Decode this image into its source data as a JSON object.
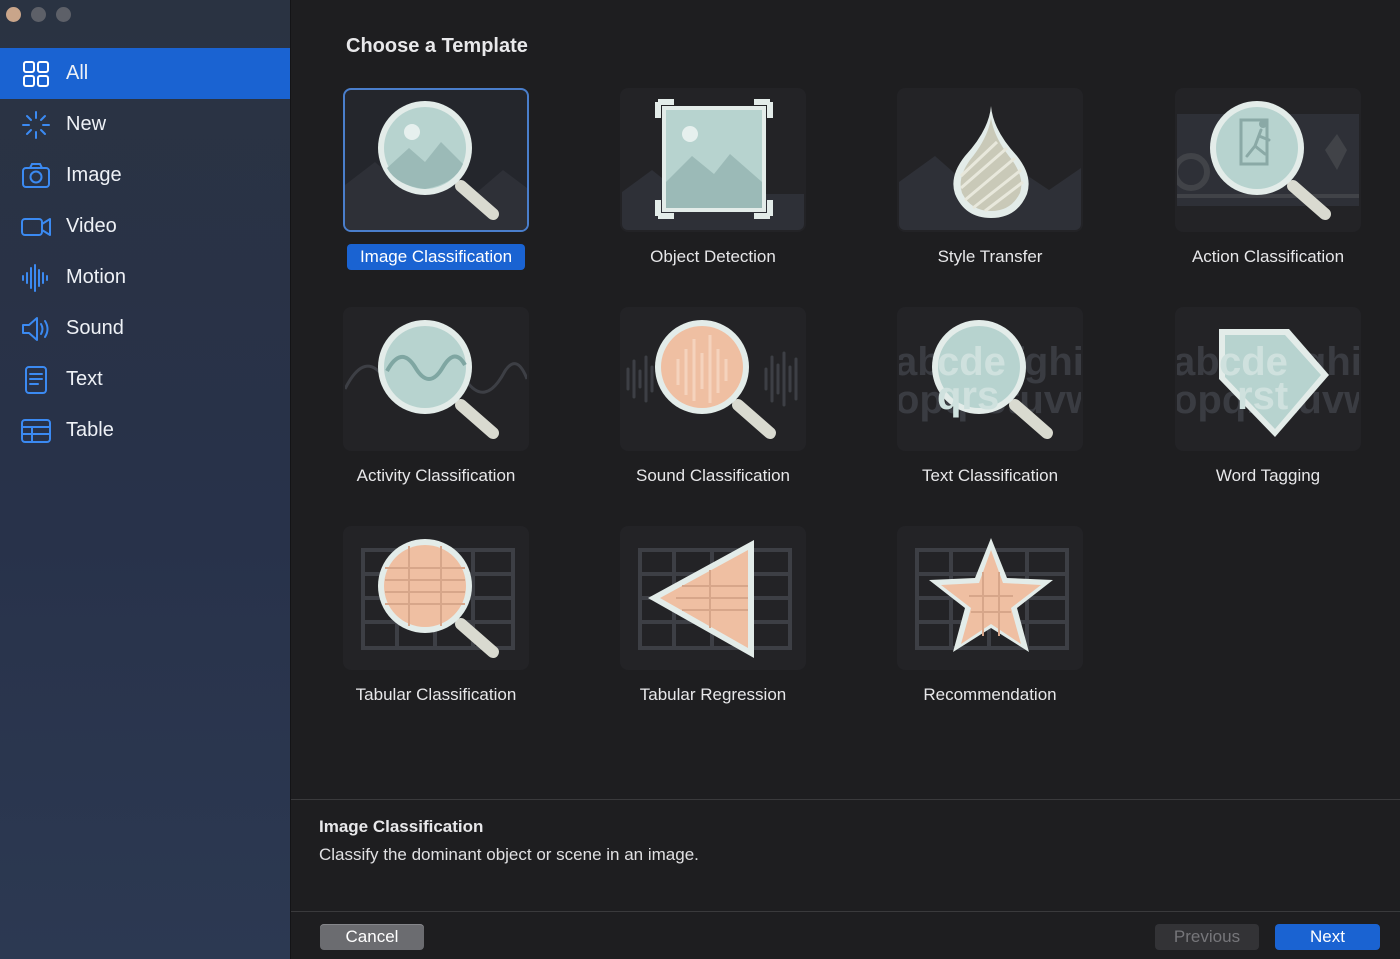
{
  "window": {
    "traffic_lights": [
      "close",
      "minimize",
      "zoom"
    ]
  },
  "sidebar": {
    "items": [
      {
        "label": "All",
        "icon": "grid-icon",
        "active": true
      },
      {
        "label": "New",
        "icon": "sparkle-icon",
        "active": false
      },
      {
        "label": "Image",
        "icon": "camera-icon",
        "active": false
      },
      {
        "label": "Video",
        "icon": "video-camera-icon",
        "active": false
      },
      {
        "label": "Motion",
        "icon": "waveform-icon",
        "active": false
      },
      {
        "label": "Sound",
        "icon": "speaker-icon",
        "active": false
      },
      {
        "label": "Text",
        "icon": "document-icon",
        "active": false
      },
      {
        "label": "Table",
        "icon": "table-icon",
        "active": false
      }
    ]
  },
  "main": {
    "heading": "Choose a Template",
    "templates": [
      {
        "label": "Image Classification",
        "icon": "magnifier-image-icon",
        "selected": true
      },
      {
        "label": "Object Detection",
        "icon": "framed-image-icon",
        "selected": false
      },
      {
        "label": "Style Transfer",
        "icon": "paint-drop-icon",
        "selected": false
      },
      {
        "label": "Action Classification",
        "icon": "magnifier-running-figure-icon",
        "selected": false
      },
      {
        "label": "Activity Classification",
        "icon": "magnifier-sine-wave-icon",
        "selected": false
      },
      {
        "label": "Sound Classification",
        "icon": "magnifier-audio-wave-icon",
        "selected": false
      },
      {
        "label": "Text Classification",
        "icon": "magnifier-letters-icon",
        "selected": false
      },
      {
        "label": "Word Tagging",
        "icon": "tag-letters-icon",
        "selected": false
      },
      {
        "label": "Tabular Classification",
        "icon": "magnifier-table-icon",
        "selected": false
      },
      {
        "label": "Tabular Regression",
        "icon": "triangle-table-icon",
        "selected": false
      },
      {
        "label": "Recommendation",
        "icon": "star-table-icon",
        "selected": false
      }
    ],
    "description": {
      "title": "Image Classification",
      "text": "Classify the dominant object or scene in an image."
    }
  },
  "footer": {
    "cancel_label": "Cancel",
    "previous_label": "Previous",
    "next_label": "Next"
  },
  "colors": {
    "accent": "#1a63d2",
    "sidebar_bg": "#2a3342",
    "main_bg": "#1e1e20",
    "icon_teal": "#a9c9c7",
    "icon_peach": "#efbfa2"
  }
}
